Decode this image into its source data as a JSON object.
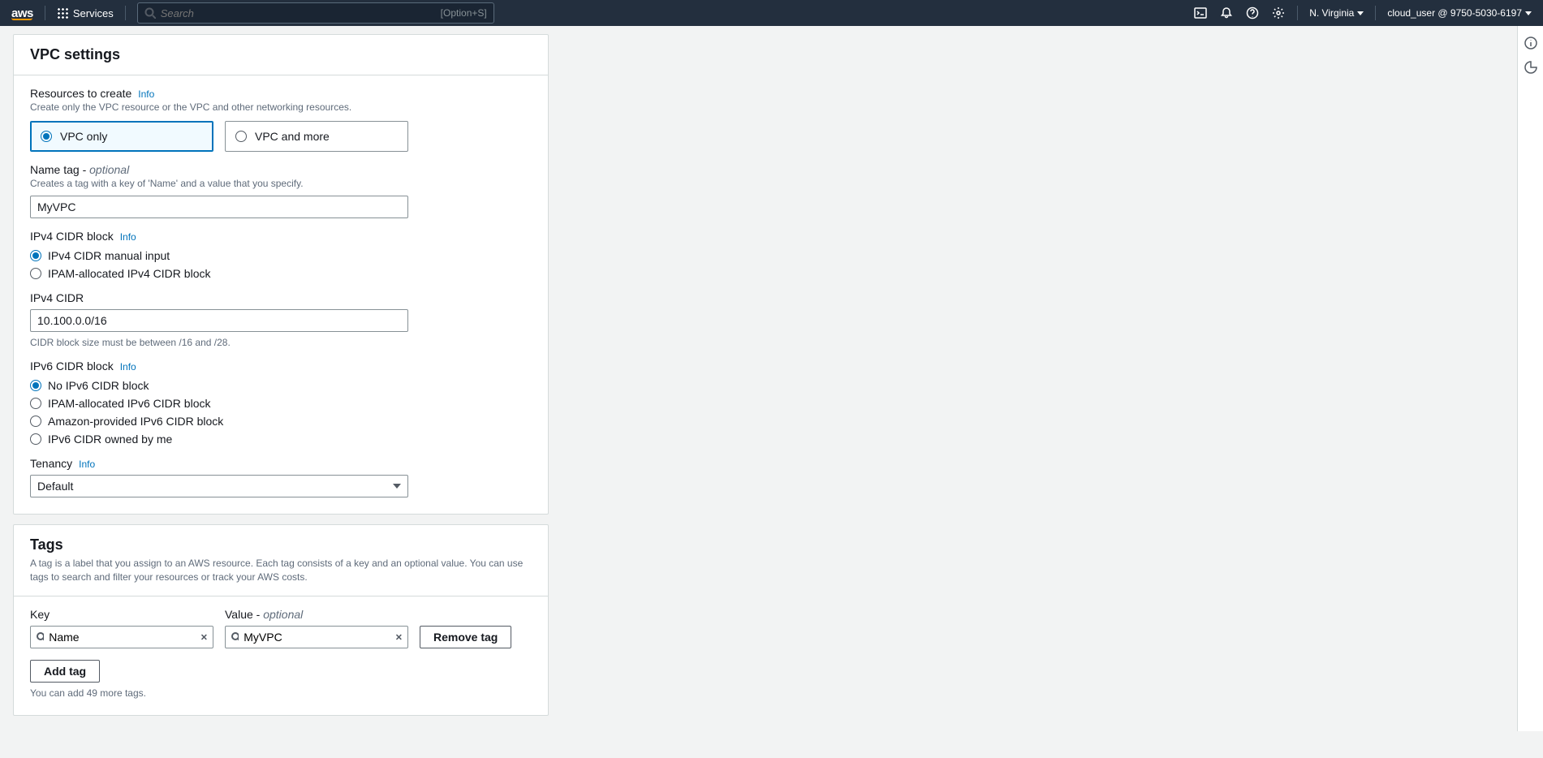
{
  "nav": {
    "services_label": "Services",
    "search_placeholder": "Search",
    "search_hint": "[Option+S]",
    "region": "N. Virginia",
    "account": "cloud_user @ 9750-5030-6197"
  },
  "vpc_panel": {
    "title": "VPC settings",
    "resources": {
      "label": "Resources to create",
      "info": "Info",
      "hint": "Create only the VPC resource or the VPC and other networking resources.",
      "option_vpc_only": "VPC only",
      "option_vpc_and_more": "VPC and more",
      "selected": "VPC only"
    },
    "name_tag": {
      "label": "Name tag - ",
      "optional": "optional",
      "hint": "Creates a tag with a key of 'Name' and a value that you specify.",
      "value": "MyVPC"
    },
    "ipv4_block": {
      "label": "IPv4 CIDR block",
      "info": "Info",
      "options": [
        "IPv4 CIDR manual input",
        "IPAM-allocated IPv4 CIDR block"
      ],
      "selected": "IPv4 CIDR manual input"
    },
    "ipv4_cidr": {
      "label": "IPv4 CIDR",
      "value": "10.100.0.0/16",
      "hint": "CIDR block size must be between /16 and /28."
    },
    "ipv6_block": {
      "label": "IPv6 CIDR block",
      "info": "Info",
      "options": [
        "No IPv6 CIDR block",
        "IPAM-allocated IPv6 CIDR block",
        "Amazon-provided IPv6 CIDR block",
        "IPv6 CIDR owned by me"
      ],
      "selected": "No IPv6 CIDR block"
    },
    "tenancy": {
      "label": "Tenancy",
      "info": "Info",
      "value": "Default"
    }
  },
  "tags_panel": {
    "title": "Tags",
    "hint": "A tag is a label that you assign to an AWS resource. Each tag consists of a key and an optional value. You can use tags to search and filter your resources or track your AWS costs.",
    "key_label": "Key",
    "value_label": "Value - ",
    "value_optional": "optional",
    "row": {
      "key": "Name",
      "value": "MyVPC"
    },
    "remove_label": "Remove tag",
    "add_label": "Add tag",
    "count_hint": "You can add 49 more tags."
  }
}
